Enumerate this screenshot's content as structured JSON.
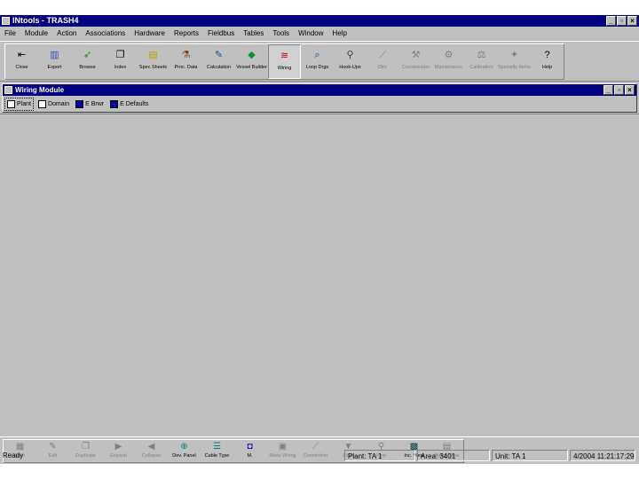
{
  "window": {
    "title": "INtools - TRASH4"
  },
  "menu": [
    "File",
    "Module",
    "Action",
    "Associations",
    "Hardware",
    "Reports",
    "Fieldbus",
    "Tables",
    "Tools",
    "Window",
    "Help"
  ],
  "toolbar": [
    {
      "label": "Close",
      "icon": "close-icon",
      "glyph": "⇤",
      "color": "#000"
    },
    {
      "label": "Export",
      "icon": "export-icon",
      "glyph": "▥",
      "color": "#3050c0"
    },
    {
      "label": "Browse",
      "icon": "browse-icon",
      "glyph": "➶",
      "color": "#208020"
    },
    {
      "label": "Index",
      "icon": "index-icon",
      "glyph": "❐",
      "color": "#000"
    },
    {
      "label": "Spec Sheets",
      "icon": "spec-sheets-icon",
      "glyph": "▤",
      "color": "#c0a000"
    },
    {
      "label": "Proc. Data",
      "icon": "proc-data-icon",
      "glyph": "⚗",
      "color": "#804000"
    },
    {
      "label": "Calculation",
      "icon": "calculation-icon",
      "glyph": "✎",
      "color": "#205080"
    },
    {
      "label": "Vessel Builder",
      "icon": "vessel-builder-icon",
      "glyph": "◆",
      "color": "#109030"
    },
    {
      "label": "Wiring",
      "icon": "wiring-icon",
      "glyph": "≋",
      "color": "#c00000",
      "active": true
    },
    {
      "label": "Loop Drgs",
      "icon": "loop-drawings-icon",
      "glyph": "⌕",
      "color": "#0040a0"
    },
    {
      "label": "Hook-Ups",
      "icon": "hook-ups-icon",
      "glyph": "⚲",
      "color": "#404040"
    },
    {
      "label": "Dim.",
      "icon": "dimensional-icon",
      "glyph": "⟋",
      "color": "#808080",
      "disabled": true
    },
    {
      "label": "Construction",
      "icon": "construction-icon",
      "glyph": "⚒",
      "color": "#808080",
      "disabled": true
    },
    {
      "label": "Maintenance",
      "icon": "maintenance-icon",
      "glyph": "⚙",
      "color": "#808080",
      "disabled": true
    },
    {
      "label": "Calibration",
      "icon": "calibration-icon",
      "glyph": "⚖",
      "color": "#808080",
      "disabled": true
    },
    {
      "label": "Specialty Items",
      "icon": "specialty-items-icon",
      "glyph": "✦",
      "color": "#808080",
      "disabled": true
    },
    {
      "label": "Help",
      "icon": "help-icon",
      "glyph": "?",
      "color": "#000"
    }
  ],
  "module": {
    "title": "Wiring Module",
    "buttons": [
      {
        "label": "Plant",
        "icon": "plant-icon",
        "selected": true
      },
      {
        "label": "Domain",
        "icon": "domain-icon"
      },
      {
        "label": "E Brwr",
        "icon": "e-browser-icon",
        "blue": true
      },
      {
        "label": "E Defaults",
        "icon": "e-defaults-icon",
        "blue": true
      }
    ]
  },
  "bottom_toolbar": [
    {
      "label": "New",
      "icon": "new-icon",
      "glyph": "▦",
      "disabled": true
    },
    {
      "label": "Edit",
      "icon": "edit-icon",
      "glyph": "✎",
      "disabled": true
    },
    {
      "label": "Duplicate",
      "icon": "duplicate-icon",
      "glyph": "❐",
      "disabled": true
    },
    {
      "label": "Expand",
      "icon": "expand-icon",
      "glyph": "▶",
      "disabled": true
    },
    {
      "label": "Collapse",
      "icon": "collapse-icon",
      "glyph": "◀",
      "disabled": true
    },
    {
      "label": "Dev. Panel",
      "icon": "device-panel-icon",
      "glyph": "⊕",
      "color": "#008080"
    },
    {
      "label": "Cable Type",
      "icon": "cable-type-icon",
      "glyph": "☰",
      "color": "#008080"
    },
    {
      "label": "M.",
      "icon": "m-icon",
      "glyph": "◘",
      "color": "#0000a0"
    },
    {
      "label": "Mass Wiring",
      "icon": "mass-wiring-icon",
      "glyph": "▣",
      "disabled": true
    },
    {
      "label": "Connection",
      "icon": "connection-icon",
      "glyph": "⟋",
      "disabled": true
    },
    {
      "label": "Filter",
      "icon": "filter-icon",
      "glyph": "▼",
      "disabled": true
    },
    {
      "label": "Find",
      "icon": "find-icon",
      "glyph": "⚲",
      "disabled": true
    },
    {
      "label": "Inc. View",
      "icon": "inc-view-icon",
      "glyph": "▩",
      "color": "#004040"
    },
    {
      "label": "Batch View",
      "icon": "batch-view-icon",
      "glyph": "▤",
      "disabled": true
    }
  ],
  "status": {
    "ready": "Ready",
    "plant": "Plant: TA 1",
    "area": "Area: 3401",
    "unit": "Unit: TA 1",
    "datetime": "4/2004 11:21:17:29"
  }
}
